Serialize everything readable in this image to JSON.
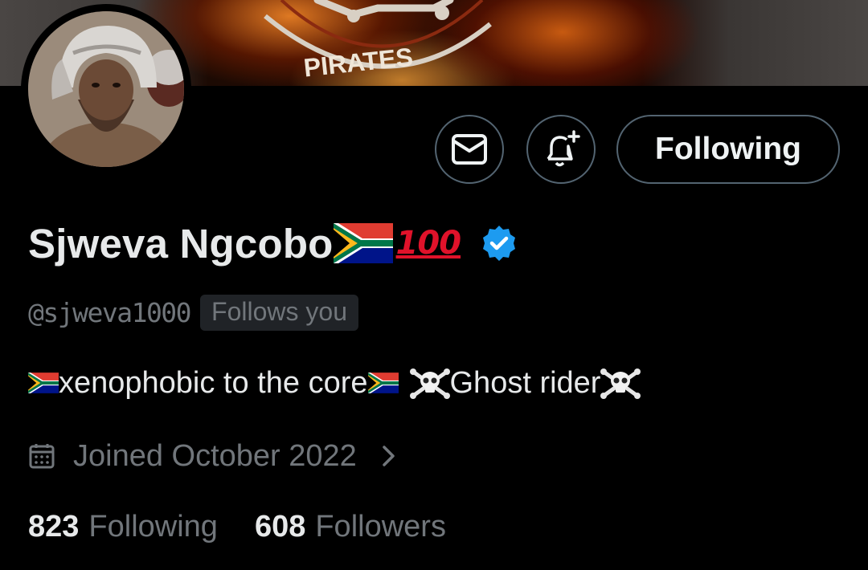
{
  "banner": {
    "text": "PIRATES"
  },
  "actions": {
    "message_icon": "mail-icon",
    "notify_icon": "bell-plus-icon",
    "following_label": "Following"
  },
  "profile": {
    "display_name": "Sjweva Ngcobo",
    "name_emoji_flag": "south-africa-flag",
    "name_emoji_hundred": "100",
    "verified": true,
    "handle": "@sjweva1000",
    "follows_you_label": "Follows you",
    "bio_part1": "xenophobic to the core",
    "bio_part2": "Ghost rider",
    "joined_text": "Joined October 2022",
    "following_count": "823",
    "following_label": "Following",
    "followers_count": "608",
    "followers_label": "Followers"
  },
  "colors": {
    "background": "#000000",
    "text_primary": "#e7e9ea",
    "text_secondary": "#71767b",
    "button_border": "#536471",
    "verified_blue": "#1d9bf0",
    "badge_bg": "#202327"
  }
}
